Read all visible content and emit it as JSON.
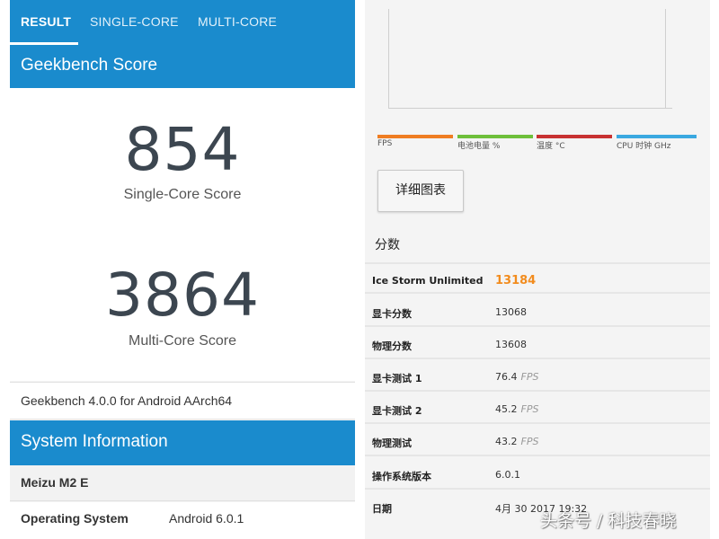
{
  "geekbench": {
    "tabs": [
      {
        "label": "RESULT",
        "active": true
      },
      {
        "label": "SINGLE-CORE",
        "active": false
      },
      {
        "label": "MULTI-CORE",
        "active": false
      }
    ],
    "score_section_title": "Geekbench Score",
    "single_core": {
      "value": "854",
      "label": "Single-Core Score"
    },
    "multi_core": {
      "value": "3864",
      "label": "Multi-Core Score"
    },
    "version_text": "Geekbench 4.0.0 for Android AArch64",
    "system_section_title": "System Information",
    "device_name": "Meizu M2 E",
    "os_row": {
      "key": "Operating System",
      "value": "Android 6.0.1"
    },
    "accent_color": "#1a8bcd"
  },
  "threedmark": {
    "legend": [
      {
        "label": "FPS",
        "color": "#ef7d22"
      },
      {
        "label": "电池电量 %",
        "color": "#6ebf3a"
      },
      {
        "label": "温度 °C",
        "color": "#c83232"
      },
      {
        "label": "CPU 时钟 GHz",
        "color": "#3aa8e0"
      }
    ],
    "detail_button_label": "详细图表",
    "scores_title": "分数",
    "rows": [
      {
        "key": "Ice Storm Unlimited",
        "value": "13184",
        "unit": "",
        "highlight": true
      },
      {
        "key": "显卡分数",
        "value": "13068",
        "unit": ""
      },
      {
        "key": "物理分数",
        "value": "13608",
        "unit": ""
      },
      {
        "key": "显卡测试 1",
        "value": "76.4",
        "unit": "FPS"
      },
      {
        "key": "显卡测试 2",
        "value": "45.2",
        "unit": "FPS"
      },
      {
        "key": "物理测试",
        "value": "43.2",
        "unit": "FPS"
      },
      {
        "key": "操作系统版本",
        "value": "6.0.1",
        "unit": ""
      },
      {
        "key": "日期",
        "value": "4月 30 2017 19:32",
        "unit": ""
      }
    ],
    "highlight_color": "#f28c1e"
  },
  "watermark": "头条号 / 科技春晓"
}
